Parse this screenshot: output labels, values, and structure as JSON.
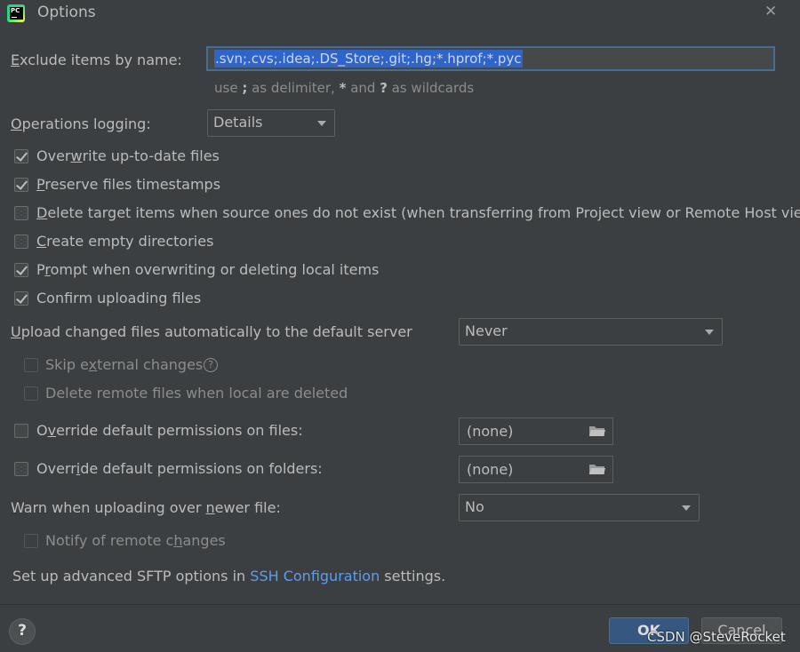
{
  "window": {
    "title": "Options",
    "app_icon_text": "PC"
  },
  "exclude": {
    "label_u": "E",
    "label_rest": "xclude items by name:",
    "value": ".svn;.cvs;.idea;.DS_Store;.git;.hg;*.hprof;*.pyc",
    "hint_a": "use ",
    "hint_semi": ";",
    "hint_b": " as delimiter, ",
    "hint_star": "*",
    "hint_c": " and ",
    "hint_q": "?",
    "hint_d": " as wildcards"
  },
  "logging": {
    "label_u": "O",
    "label_rest": "perations logging:",
    "selected": "Details"
  },
  "checks": [
    {
      "pre": "Over",
      "u": "w",
      "post": "rite up-to-date files",
      "checked": true
    },
    {
      "pre": "",
      "u": "P",
      "post": "reserve files timestamps",
      "checked": true
    },
    {
      "pre": "",
      "u": "D",
      "post": "elete target items when source ones do not exist (when transferring from Project view or Remote Host view)",
      "checked": false
    },
    {
      "pre": "",
      "u": "C",
      "post": "reate empty directories",
      "checked": false
    },
    {
      "pre": "P",
      "u": "r",
      "post": "ompt when overwriting or deleting local items",
      "checked": true
    },
    {
      "pre": "Confirm uploading files",
      "u": "",
      "post": "",
      "checked": true
    }
  ],
  "upload": {
    "label_u": "U",
    "label_rest": "pload changed files automatically to the default server",
    "selected": "Never",
    "skip_pre": "Skip e",
    "skip_u": "x",
    "skip_post": "ternal changes",
    "delete_remote": "Delete remote files when local are deleted"
  },
  "perm_files": {
    "pre": "O",
    "u": "v",
    "post": "erride default permissions on files:",
    "value": "(none)"
  },
  "perm_folders": {
    "pre": "Overr",
    "u": "i",
    "post": "de default permissions on folders:",
    "value": "(none)"
  },
  "warn": {
    "pre": "Warn when uploading over ",
    "u": "n",
    "post": "ewer file:",
    "selected": "No"
  },
  "notify": {
    "pre": "Notify of remote c",
    "u": "h",
    "post": "anges"
  },
  "sftp": {
    "pre": "Set up advanced SFTP options in ",
    "link": "SSH Configuration",
    "post": " settings."
  },
  "footer": {
    "help": "?",
    "ok": "OK",
    "cancel": "Cancel"
  },
  "watermark": "CSDN @SteveRocket"
}
